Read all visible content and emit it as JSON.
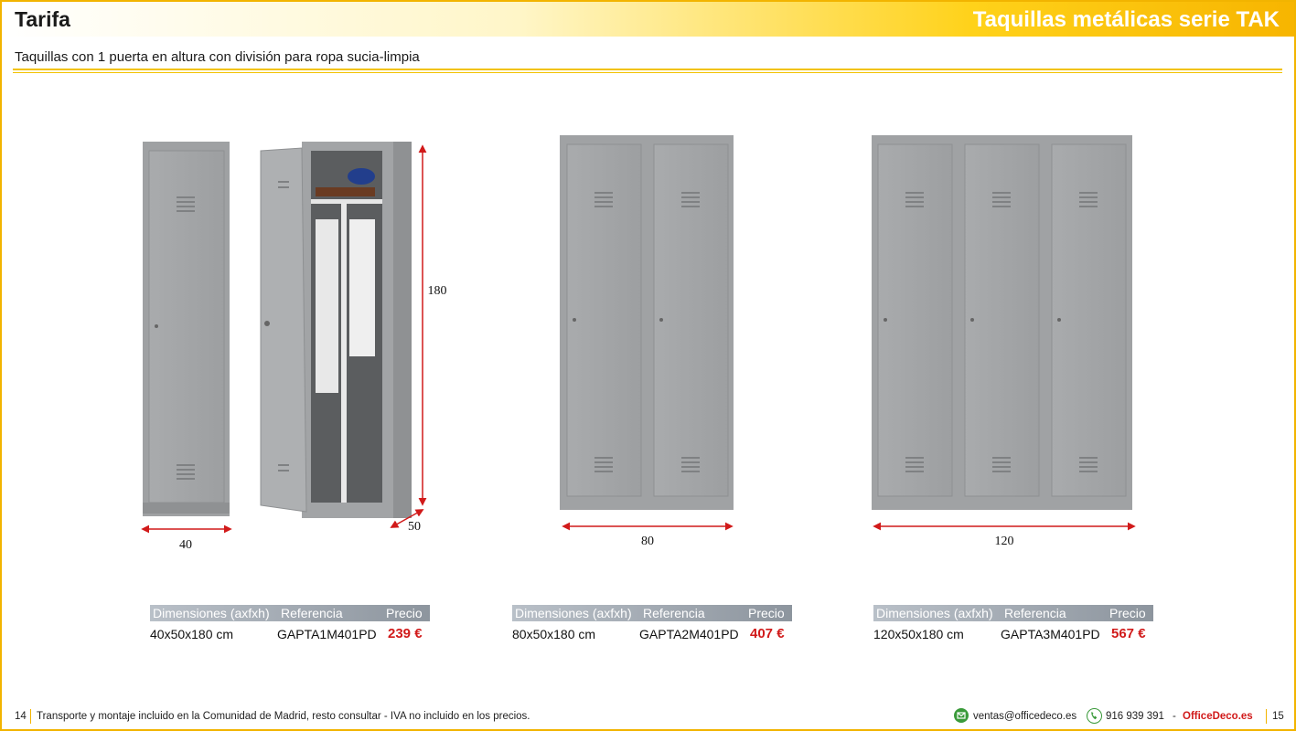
{
  "header": {
    "section": "Tarifa",
    "title": "Taquillas metálicas serie TAK"
  },
  "subtitle": "Taquillas con 1 puerta en altura con división para ropa sucia-limpia",
  "dimensions_labels": {
    "width_1": "40",
    "depth": "50",
    "height": "180",
    "width_2": "80",
    "width_3": "120"
  },
  "tables": [
    {
      "headers": [
        "Dimensiones (axfxh)",
        "Referencia",
        "Precio"
      ],
      "dimension": "40x50x180 cm",
      "reference": "GAPTA1M401PD",
      "price": "239 €"
    },
    {
      "headers": [
        "Dimensiones (axfxh)",
        "Referencia",
        "Precio"
      ],
      "dimension": "80x50x180 cm",
      "reference": "GAPTA2M401PD",
      "price": "407 €"
    },
    {
      "headers": [
        "Dimensiones (axfxh)",
        "Referencia",
        "Precio"
      ],
      "dimension": "120x50x180 cm",
      "reference": "GAPTA3M401PD",
      "price": "567 €"
    }
  ],
  "footer": {
    "page_left": "14",
    "note": "Transporte y montaje incluido en la Comunidad de Madrid, resto consultar - IVA no incluido en los precios.",
    "email": "ventas@officedeco.es",
    "phone": "916 939 391",
    "dash": "-",
    "brand": "OfficeDeco.es",
    "page_right": "15",
    "icons": [
      "email-icon",
      "phone-icon"
    ]
  },
  "colors": {
    "accent_yellow": "#f2b400",
    "price_red": "#d11a1a",
    "table_header_gray": "#9aa1a9",
    "locker_gray": "#a4a6a8",
    "arrow_red": "#d11a1a"
  }
}
